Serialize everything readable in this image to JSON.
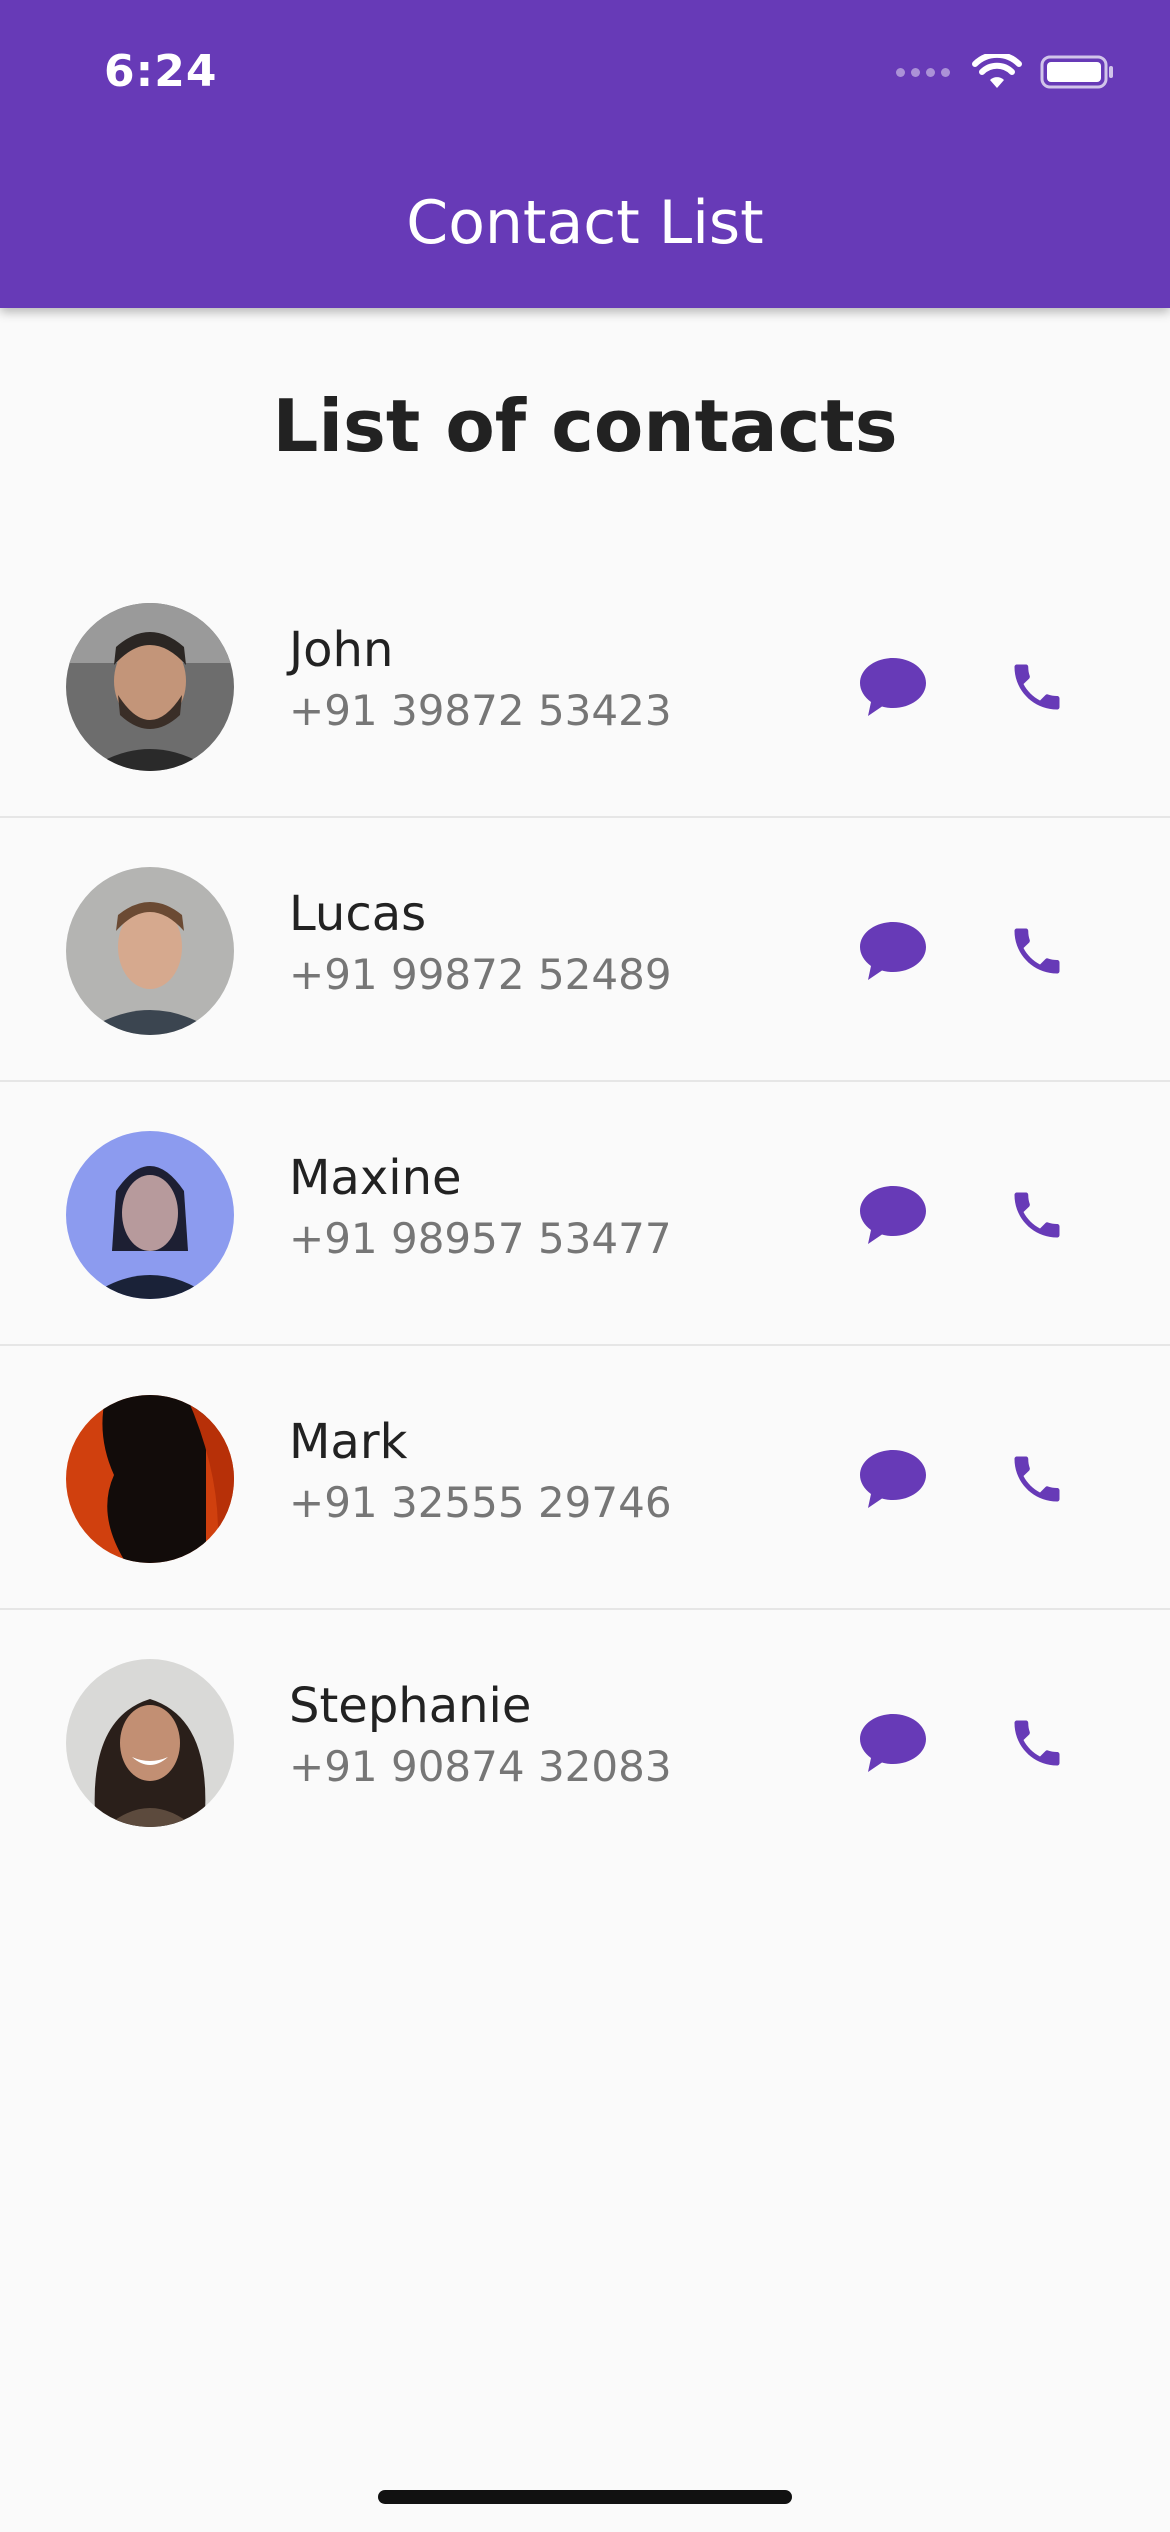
{
  "status_bar": {
    "time": "6:24",
    "icons": [
      "cellular-signal-icon",
      "wifi-icon",
      "battery-icon"
    ]
  },
  "app_bar": {
    "title": "Contact List",
    "color": "#673ab7"
  },
  "main": {
    "heading": "List of contacts",
    "contacts": [
      {
        "name": "John",
        "phone": "+91 39872 53423",
        "avatar": "avatar-john"
      },
      {
        "name": "Lucas",
        "phone": "+91 99872 52489",
        "avatar": "avatar-lucas"
      },
      {
        "name": "Maxine",
        "phone": "+91 98957 53477",
        "avatar": "avatar-maxine"
      },
      {
        "name": "Mark",
        "phone": "+91 32555 29746",
        "avatar": "avatar-mark"
      },
      {
        "name": "Stephanie",
        "phone": "+91 90874 32083",
        "avatar": "avatar-stephanie"
      }
    ],
    "action_icons": [
      "message-icon",
      "phone-icon"
    ]
  },
  "colors": {
    "accent": "#673ab7",
    "background": "#fafafa",
    "text_primary": "#222222",
    "text_secondary": "#767676"
  }
}
